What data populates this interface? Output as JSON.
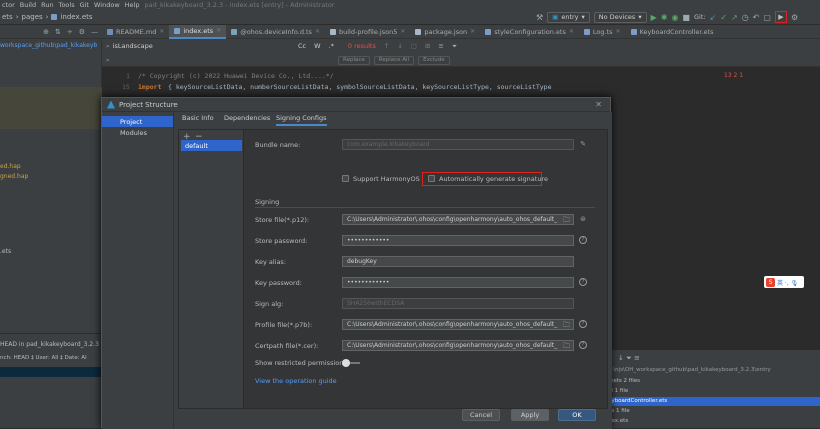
{
  "menubar": {
    "items": [
      "ctor",
      "Build",
      "Run",
      "Tools",
      "Git",
      "Window",
      "Help"
    ],
    "title": "pad_kikakeyboard_3.2.3 - index.ets [entry] - Administrator"
  },
  "navbar": {
    "breadcrumb": [
      "ets",
      "pages",
      "index.ets"
    ],
    "run_config": "entry",
    "device": "No Devices",
    "git_label": "Git:"
  },
  "tabs": [
    {
      "label": "README.md",
      "color": "#6e8fb5"
    },
    {
      "label": "index.ets",
      "color": "#7b9fc4",
      "active": true
    },
    {
      "label": "@ohos.deviceInfo.d.ts",
      "color": "#7ba3b8"
    },
    {
      "label": "build-profile.json5",
      "color": "#a9b7c6"
    },
    {
      "label": "package.json",
      "color": "#a9b7c6"
    },
    {
      "label": "styleConfiguration.ets",
      "color": "#7b9fc4"
    },
    {
      "label": "Log.ts",
      "color": "#7b9fc4"
    },
    {
      "label": "KeyboardController.ets",
      "color": "#7b9fc4"
    }
  ],
  "project_panel": {
    "path": "workspace_github\\pad_kikakeyb",
    "items": [
      "ed.hap",
      "gned.hap",
      ".ets"
    ],
    "git_head": "HEAD in pad_kikakeyboard_3.2.3",
    "git_filter": "nch: HEAD ‡  User: All ‡  Date: Al"
  },
  "find": {
    "query": "isLandscape",
    "cc": "Cc",
    "w": "W",
    "regex": ".*",
    "results": "0 results",
    "replace_label": "Replace",
    "replace_all_label": "Replace All",
    "exclude_label": "Exclude"
  },
  "editor": {
    "line1_num": "1",
    "line1": "/*  Copyright (c) 2022 Huawei Device Co., Ltd....*/",
    "line2_num": "15",
    "line2_kw": "import",
    "line2": " { keySourceListData, numberSourceListData, symbolSourceListData, keySourceListType, sourceListType",
    "inspections": "13  2  1"
  },
  "bottom_panel": {
    "path": "E:\\njs\\OH_workspace_github\\pad_kikakeyboard_3.2.3\\entry",
    "lines": [
      "n\\ets  2 files",
      "el  1 file",
      "eyboardController.ets",
      "es  1 file",
      "dex.ets"
    ]
  },
  "dialog": {
    "title": "Project Structure",
    "side_items": [
      "Project",
      "Modules"
    ],
    "tabs": [
      "Basic Info",
      "Dependencies",
      "Signing Configs"
    ],
    "list_add": "+",
    "list_remove": "−",
    "default_item": "default",
    "bundle_label": "Bundle name:",
    "bundle_value": "com.example.kikakeyboard",
    "support_harmony": "Support HarmonyOS",
    "auto_sign": "Automatically generate signature",
    "signing_header": "Signing",
    "store_file_label": "Store file(*.p12):",
    "store_file_value": "C:\\Users\\Administrator\\.ohos\\config\\openharmony\\auto_ohos_default_",
    "store_password_label": "Store password:",
    "store_password_value": "••••••••••••",
    "key_alias_label": "Key alias:",
    "key_alias_value": "debugKey",
    "key_password_label": "Key password:",
    "key_password_value": "••••••••••••",
    "sign_alg_label": "Sign alg:",
    "sign_alg_value": "SHA256withECDSA",
    "profile_label": "Profile file(*.p7b):",
    "profile_value": "C:\\Users\\Administrator\\.ohos\\config\\openharmony\\auto_ohos_default_",
    "certpath_label": "Certpath file(*.cer):",
    "certpath_value": "C:\\Users\\Administrator\\.ohos\\config\\openharmony\\auto_ohos_default_",
    "show_passwords": "Show restricted permissions",
    "view_guide": "View the operation guide",
    "cancel": "Cancel",
    "apply": "Apply",
    "ok": "OK"
  },
  "ime": {
    "label": "英 ·, 🎙"
  }
}
